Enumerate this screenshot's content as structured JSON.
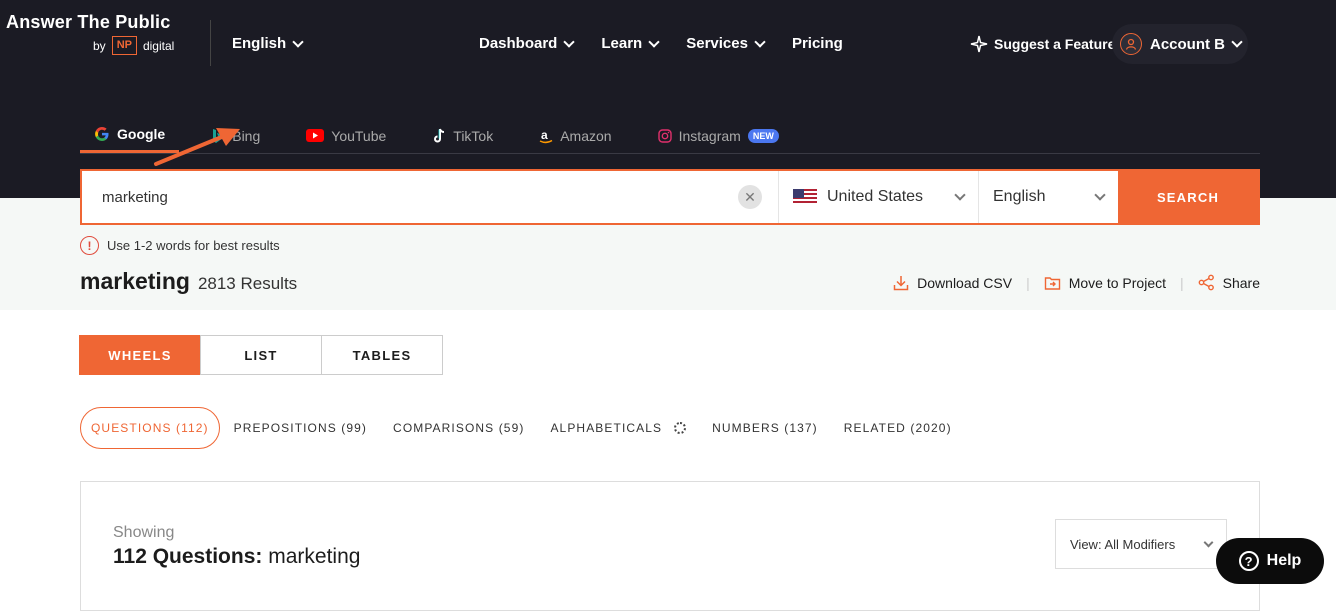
{
  "header": {
    "logo_title": "Answer The Public",
    "logo_by": "by",
    "logo_np": "NP",
    "logo_digital": "digital",
    "language": "English",
    "nav": [
      "Dashboard",
      "Learn",
      "Services",
      "Pricing"
    ],
    "suggest": "Suggest a Feature",
    "account": "Account B"
  },
  "engines": {
    "tabs": [
      "Google",
      "Bing",
      "YouTube",
      "TikTok",
      "Amazon",
      "Instagram"
    ],
    "instagram_badge": "NEW",
    "active": "Google"
  },
  "search": {
    "value": "marketing",
    "country": "United States",
    "language": "English",
    "button": "SEARCH"
  },
  "hint": "Use 1-2 words for best results",
  "results": {
    "keyword": "marketing",
    "count": "2813 Results",
    "actions": [
      "Download CSV",
      "Move to Project",
      "Share"
    ]
  },
  "views": {
    "tabs": [
      "WHEELS",
      "LIST",
      "TABLES"
    ],
    "active": "WHEELS"
  },
  "filters": [
    "QUESTIONS (112)",
    "PREPOSITIONS (99)",
    "COMPARISONS (59)",
    "ALPHABETICALS",
    "NUMBERS (137)",
    "RELATED (2020)"
  ],
  "panel": {
    "showing": "Showing",
    "title_bold": "112 Questions:",
    "title_rest": " marketing",
    "view_select": "View: All Modifiers"
  },
  "help": "Help",
  "colors": {
    "accent": "#ef6634",
    "dark": "#1b1b24"
  }
}
